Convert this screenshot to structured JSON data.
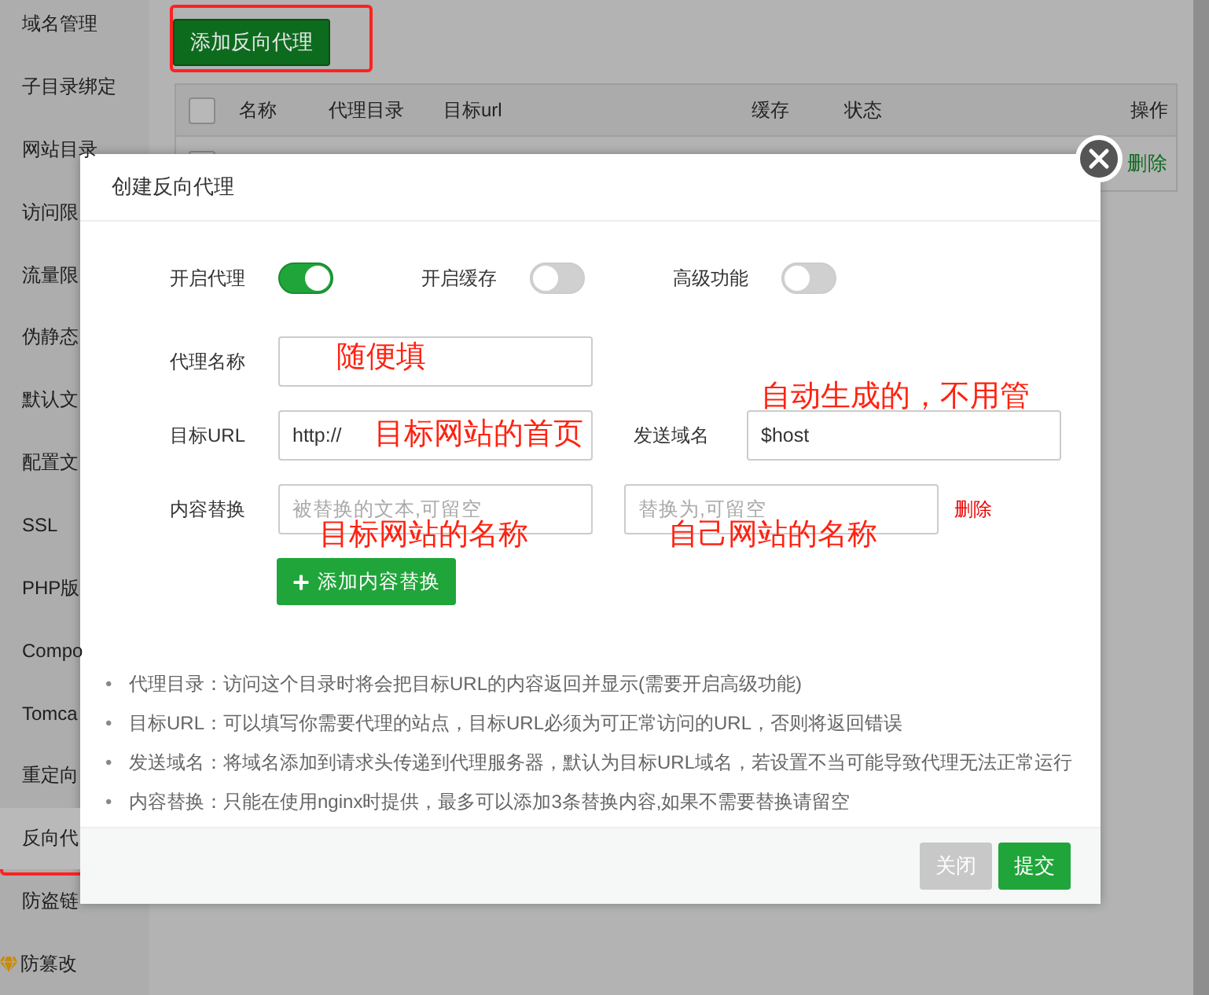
{
  "sidebar": {
    "items": [
      {
        "label": "域名管理",
        "selected": false
      },
      {
        "label": "子目录绑定",
        "selected": false
      },
      {
        "label": "网站目录",
        "selected": false
      },
      {
        "label": "访问限",
        "selected": false
      },
      {
        "label": "流量限",
        "selected": false
      },
      {
        "label": "伪静态",
        "selected": false
      },
      {
        "label": "默认文",
        "selected": false
      },
      {
        "label": "配置文",
        "selected": false
      },
      {
        "label": "SSL",
        "selected": false
      },
      {
        "label": "PHP版",
        "selected": false
      },
      {
        "label": "Compo",
        "selected": false
      },
      {
        "label": "Tomca",
        "selected": false
      },
      {
        "label": "重定向",
        "selected": false
      },
      {
        "label": "反向代",
        "selected": true
      },
      {
        "label": "防盗链",
        "selected": false
      },
      {
        "label": "防篡改",
        "selected": false,
        "premium": true
      }
    ]
  },
  "add_button": "添加反向代理",
  "table": {
    "select_all_checked": false,
    "columns": [
      "名称",
      "代理目录",
      "目标url",
      "缓存",
      "状态",
      "操作"
    ],
    "rows": [
      {
        "checked": false,
        "action": "删除"
      }
    ]
  },
  "dialog": {
    "title": "创建反向代理",
    "toggles": [
      {
        "label": "开启代理",
        "on": true
      },
      {
        "label": "开启缓存",
        "on": false
      },
      {
        "label": "高级功能",
        "on": false
      }
    ],
    "name_field": {
      "label": "代理名称"
    },
    "target_url": {
      "label": "目标URL",
      "value": "http://"
    },
    "send_domain": {
      "label": "发送域名",
      "value": "$host"
    },
    "replace": {
      "label": "内容替换",
      "from_placeholder": "被替换的文本,可留空",
      "to_placeholder": "替换为,可留空",
      "delete": "删除"
    },
    "add_replace_button": "添加内容替换",
    "bullet": "•",
    "notes": [
      "代理目录：访问这个目录时将会把目标URL的内容返回并显示(需要开启高级功能)",
      "目标URL：可以填写你需要代理的站点，目标URL必须为可正常访问的URL，否则将返回错误",
      "发送域名：将域名添加到请求头传递到代理服务器，默认为目标URL域名，若设置不当可能导致代理无法正常运行",
      "内容替换：只能在使用nginx时提供，最多可以添加3条替换内容,如果不需要替换请留空"
    ],
    "buttons": [
      {
        "label": "关闭",
        "kind": "secondary"
      },
      {
        "label": "提交",
        "kind": "primary"
      }
    ]
  },
  "annotations": [
    {
      "text": "随便填"
    },
    {
      "text": "目标网站的首页"
    },
    {
      "text": "自动生成的，不用管"
    },
    {
      "text": "目标网站的名称"
    },
    {
      "text": "自己网站的名称"
    }
  ]
}
